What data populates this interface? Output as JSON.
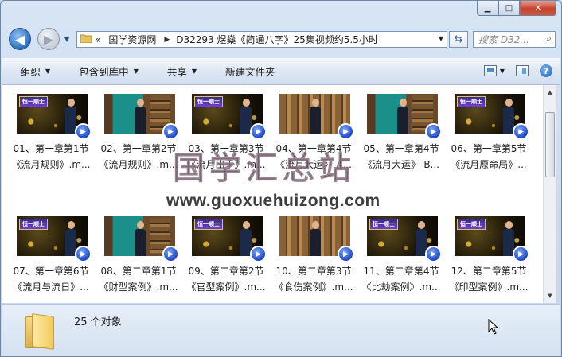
{
  "caption": {
    "minimize_icon": "minimize-icon",
    "maximize_icon": "maximize-icon",
    "close_icon": "close-icon"
  },
  "address": {
    "crumbs": [
      "«",
      "国学资源网",
      "D32293 煜燊《简通八字》25集视频约5.5小时"
    ],
    "search_placeholder": "搜索 D32..."
  },
  "toolbar": {
    "organize": "组织",
    "include": "包含到库中",
    "share": "共享",
    "new_folder": "新建文件夹"
  },
  "files": [
    {
      "line1": "01、第一章第1节",
      "line2": "《流月规则》.m...",
      "thumb": "gold"
    },
    {
      "line1": "02、第一章第2节",
      "line2": "《流月规则》.m...",
      "thumb": "library"
    },
    {
      "line1": "03、第一章第3节",
      "line2": "《流月出手》.m...",
      "thumb": "gold"
    },
    {
      "line1": "04、第一章第4节",
      "line2": "《流月大运》-A...",
      "thumb": "wood"
    },
    {
      "line1": "05、第一章第4节",
      "line2": "《流月大运》-B...",
      "thumb": "library"
    },
    {
      "line1": "06、第一章第5节",
      "line2": "《流月原命局》...",
      "thumb": "gold"
    },
    {
      "line1": "07、第一章第6节",
      "line2": "《流月与流日》...",
      "thumb": "gold"
    },
    {
      "line1": "08、第二章第1节",
      "line2": "《财型案例》.m...",
      "thumb": "library"
    },
    {
      "line1": "09、第二章第2节",
      "line2": "《官型案例》.m...",
      "thumb": "gold"
    },
    {
      "line1": "10、第二章第3节",
      "line2": "《食伤案例》.m...",
      "thumb": "wood"
    },
    {
      "line1": "11、第二章第4节",
      "line2": "《比劫案例》.m...",
      "thumb": "gold"
    },
    {
      "line1": "12、第二章第5节",
      "line2": "《印型案例》.m...",
      "thumb": "gold"
    }
  ],
  "badge_text": "恒一顺士",
  "watermark": {
    "cn": "国学汇总站",
    "url": "www.guoxuehuizong.com"
  },
  "status": {
    "count": "25 个对象"
  }
}
